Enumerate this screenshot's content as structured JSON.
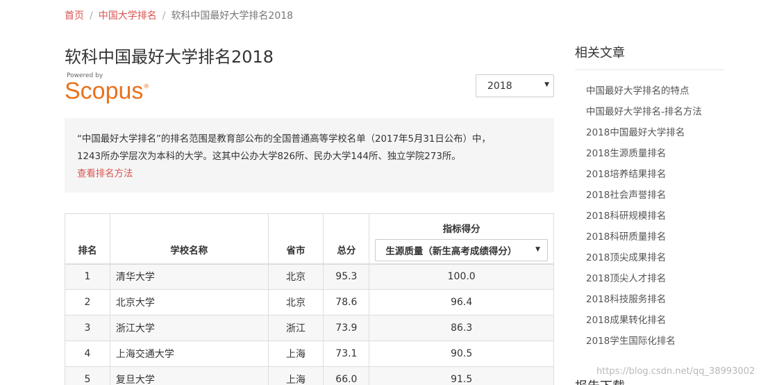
{
  "breadcrumb": {
    "home": "首页",
    "category": "中国大学排名",
    "current": "软科中国最好大学排名2018",
    "separator": "/"
  },
  "page_title": "软科中国最好大学排名2018",
  "scopus": {
    "powered_by": "Powered by",
    "brand": "Scopus",
    "reg": "®"
  },
  "year_select": {
    "value": "2018",
    "arrow": "▼"
  },
  "info": {
    "line1": "“中国最好大学排名”的排名范围是教育部公布的全国普通高等学校名单（2017年5月31日公布）中，",
    "line2": "1243所办学层次为本科的大学。这其中公办大学826所、民办大学144所、独立学院273所。",
    "link": "查看排名方法"
  },
  "table": {
    "headers": {
      "rank": "排名",
      "name": "学校名称",
      "province": "省市",
      "total": "总分",
      "indicator_title": "指标得分",
      "indicator_select": "生源质量（新生高考成绩得分）",
      "arrow": "▼"
    },
    "rows": [
      {
        "rank": "1",
        "name": "清华大学",
        "province": "北京",
        "total": "95.3",
        "score": "100.0"
      },
      {
        "rank": "2",
        "name": "北京大学",
        "province": "北京",
        "total": "78.6",
        "score": "96.4"
      },
      {
        "rank": "3",
        "name": "浙江大学",
        "province": "浙江",
        "total": "73.9",
        "score": "86.3"
      },
      {
        "rank": "4",
        "name": "上海交通大学",
        "province": "上海",
        "total": "73.1",
        "score": "90.5"
      },
      {
        "rank": "5",
        "name": "复旦大学",
        "province": "上海",
        "total": "66.0",
        "score": "91.5"
      }
    ]
  },
  "sidebar": {
    "title": "相关文章",
    "items": [
      "中国最好大学排名的特点",
      "中国最好大学排名-排名方法",
      "2018中国最好大学排名",
      "2018生源质量排名",
      "2018培养结果排名",
      "2018社会声誉排名",
      "2018科研规模排名",
      "2018科研质量排名",
      "2018顶尖成果排名",
      "2018顶尖人才排名",
      "2018科技服务排名",
      "2018成果转化排名",
      "2018学生国际化排名"
    ],
    "second_title": "报告下载"
  },
  "watermark": "https://blog.csdn.net/qq_38993002"
}
